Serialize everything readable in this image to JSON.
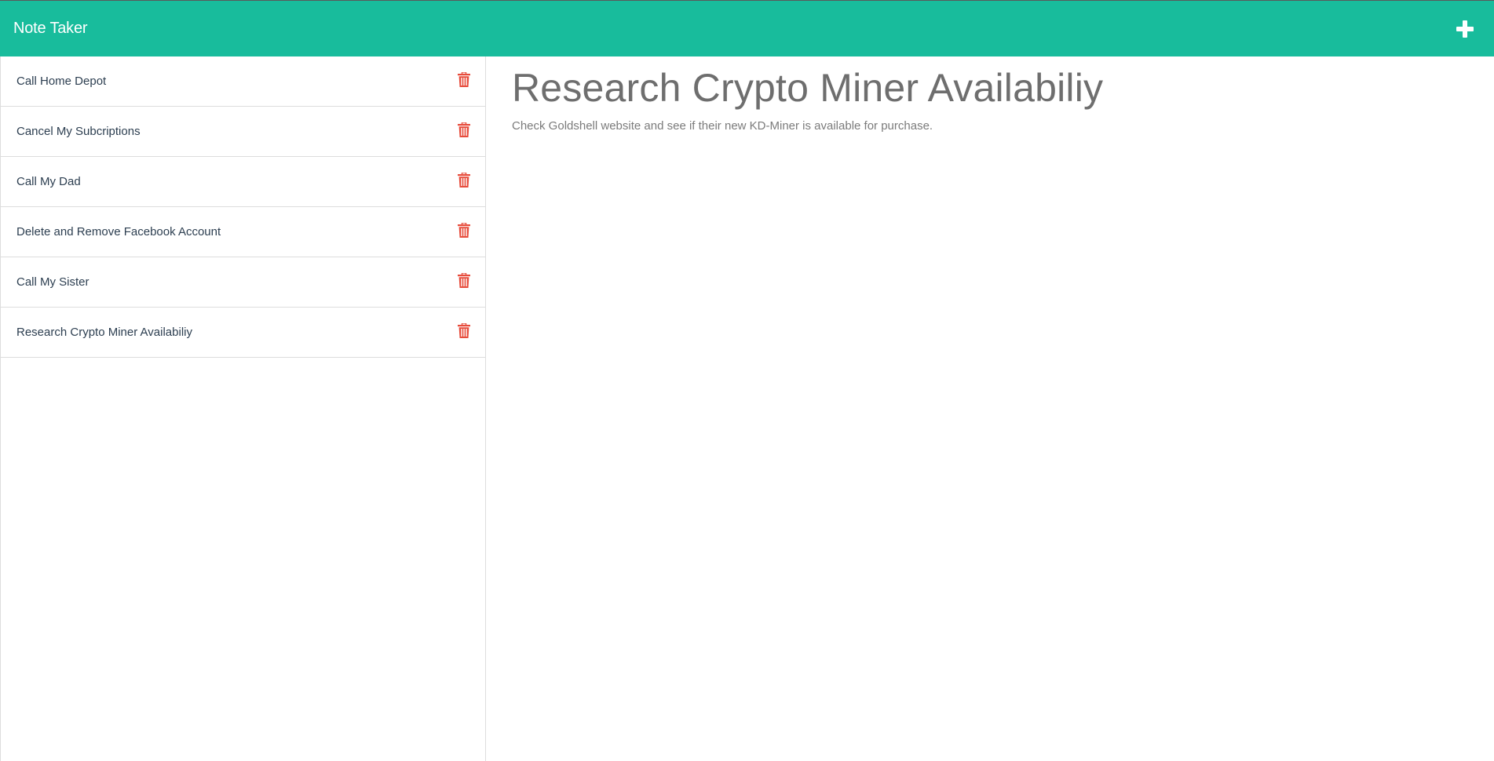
{
  "navbar": {
    "brand": "Note Taker",
    "new_note_icon": "plus-icon"
  },
  "colors": {
    "navbar_bg": "#18bc9c",
    "delete_icon": "#e74c3c",
    "note_text": "#2c3e50"
  },
  "notes": [
    {
      "title": "Call Home Depot",
      "icon": "trash-icon"
    },
    {
      "title": "Cancel My Subcriptions",
      "icon": "trash-icon"
    },
    {
      "title": "Call My Dad",
      "icon": "trash-icon"
    },
    {
      "title": "Delete and Remove Facebook Account",
      "icon": "trash-icon"
    },
    {
      "title": "Call My Sister",
      "icon": "trash-icon"
    },
    {
      "title": "Research Crypto Miner Availabiliy",
      "icon": "trash-icon"
    }
  ],
  "active_note": {
    "title": "Research Crypto Miner Availabiliy",
    "text": "Check Goldshell website and see if their new KD-Miner is available for purchase."
  }
}
